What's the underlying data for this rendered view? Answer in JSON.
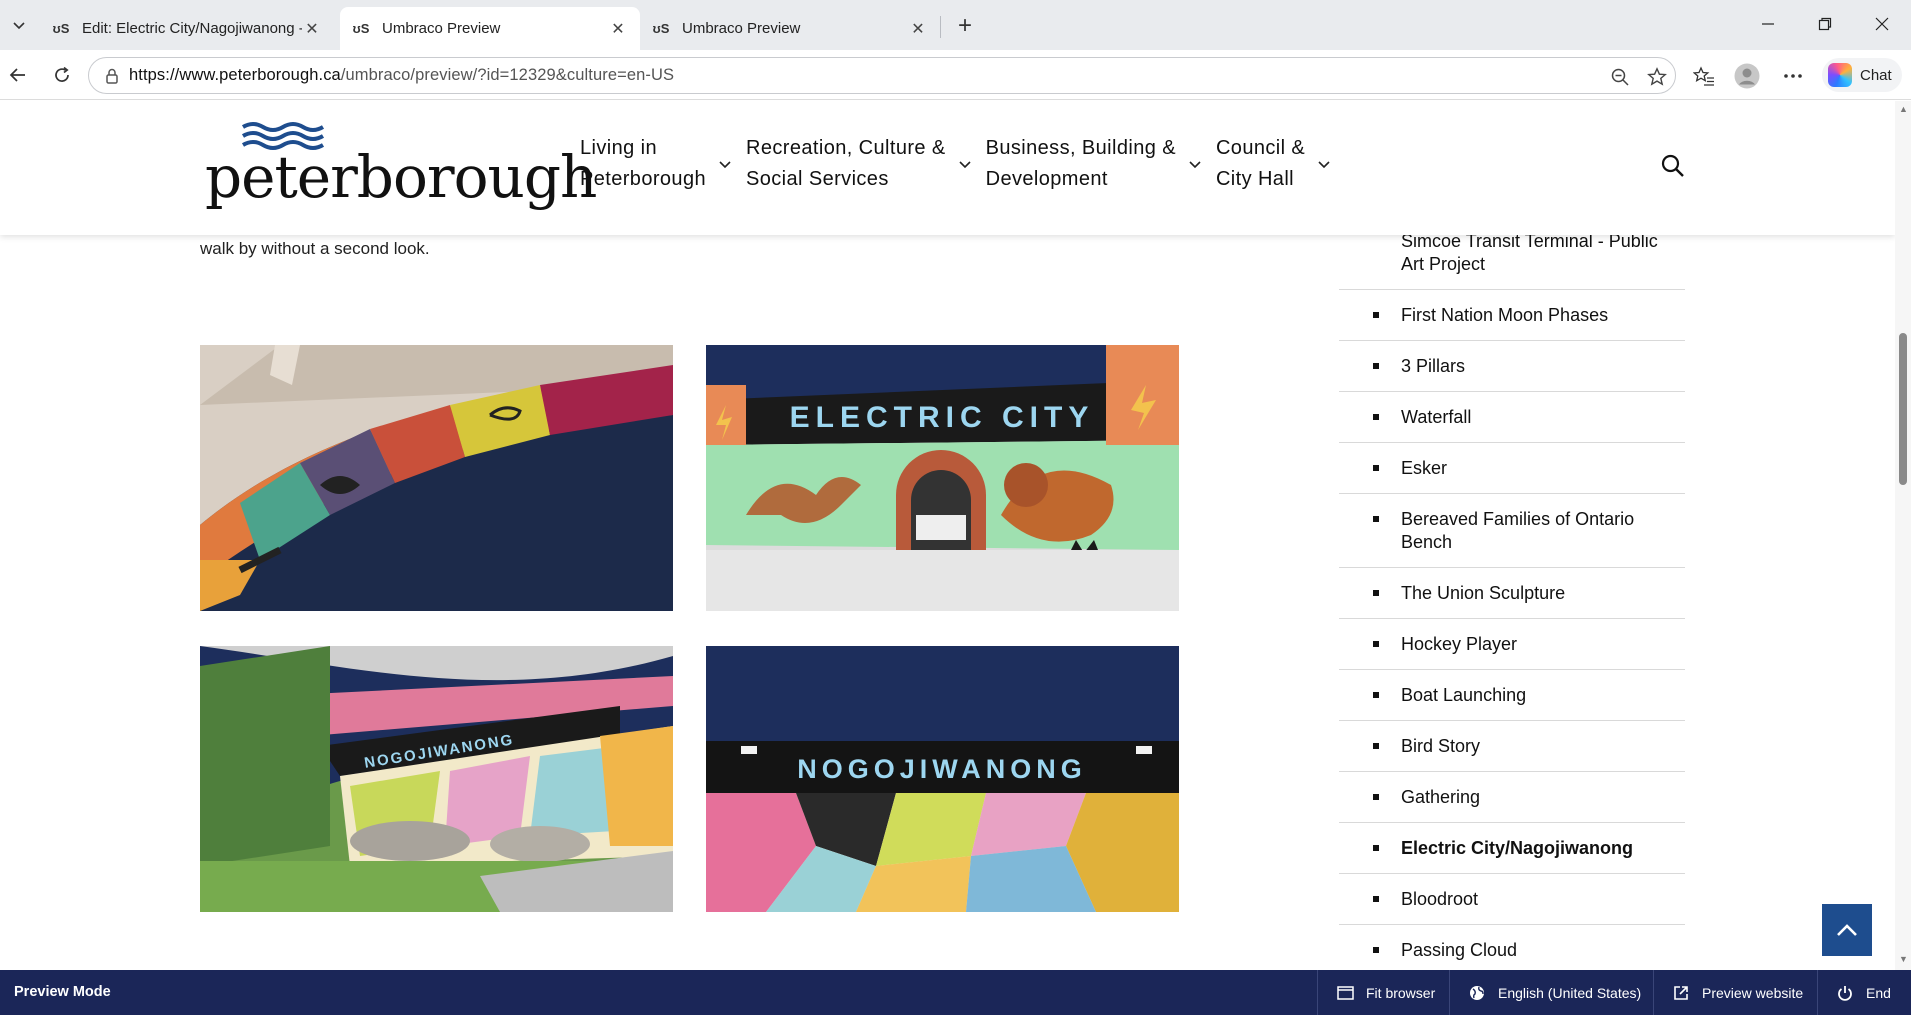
{
  "browser": {
    "tabs": [
      {
        "title": "Edit: Electric City/Nagojiwanong - ",
        "active": false
      },
      {
        "title": "Umbraco Preview",
        "active": true
      },
      {
        "title": "Umbraco Preview",
        "active": false
      }
    ],
    "url_host": "https://www.peterborough.ca",
    "url_path": "/umbraco/preview/?id=12329&culture=en-US",
    "chat_label": "Chat"
  },
  "site": {
    "logo_text": "peterborough",
    "nav": [
      {
        "line1": "Living in",
        "line2": "Peterborough"
      },
      {
        "line1": "Recreation, Culture &",
        "line2": "Social Services"
      },
      {
        "line1": "Business, Building &",
        "line2": "Development"
      },
      {
        "line1": "Council &",
        "line2": "City Hall"
      }
    ],
    "brand_color": "#1e4d8e"
  },
  "content": {
    "intro_tail": "walk by without a second look.",
    "images": [
      {
        "alt": "Underpass arch with coloured blocks and symbols"
      },
      {
        "alt": "Electric City mural with deer, lion and lightning bolts",
        "sign": "ELECTRIC CITY"
      },
      {
        "alt": "Nogojiwanong mural with patterned shapes and boulders",
        "sign": "NOGOJIWANONG"
      },
      {
        "alt": "Close-up of Nogojiwanong sign over patterned mural",
        "sign": "NOGOJIWANONG"
      }
    ]
  },
  "sidebar": {
    "items": [
      {
        "label": "Simcoe Transit Terminal - Public Art Project",
        "current": false
      },
      {
        "label": "First Nation Moon Phases",
        "current": false
      },
      {
        "label": "3 Pillars",
        "current": false
      },
      {
        "label": "Waterfall",
        "current": false
      },
      {
        "label": "Esker",
        "current": false
      },
      {
        "label": "Bereaved Families of Ontario Bench",
        "current": false
      },
      {
        "label": "The Union Sculpture",
        "current": false
      },
      {
        "label": "Hockey Player",
        "current": false
      },
      {
        "label": "Boat Launching",
        "current": false
      },
      {
        "label": "Bird Story",
        "current": false
      },
      {
        "label": "Gathering",
        "current": false
      },
      {
        "label": "Electric City/Nagojiwanong",
        "current": true
      },
      {
        "label": "Bloodroot",
        "current": false
      },
      {
        "label": "Passing Cloud",
        "current": false
      }
    ]
  },
  "preview_bar": {
    "mode_label": "Preview Mode",
    "fit_browser": "Fit browser",
    "language": "English (United States)",
    "preview_website": "Preview website",
    "end": "End"
  }
}
